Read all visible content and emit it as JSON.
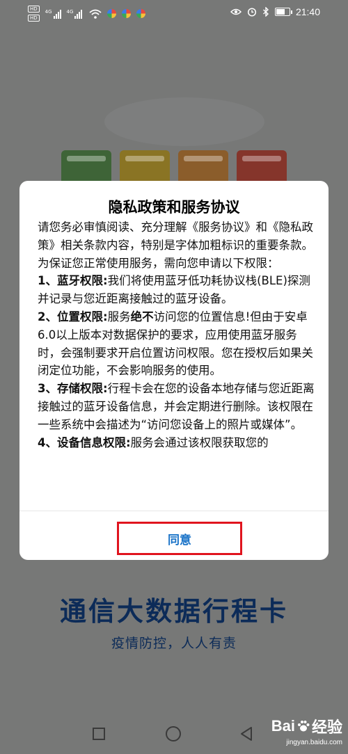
{
  "status_bar": {
    "left_badges": [
      "HD",
      "HD"
    ],
    "network_tags": [
      "4G",
      "4G"
    ],
    "time": "21:40",
    "battery_level": 0.75,
    "icons": [
      "eye-icon",
      "alarm-icon",
      "bluetooth-icon",
      "battery-icon"
    ]
  },
  "background": {
    "title": "通信大数据行程卡",
    "subtitle": "疫情防控，人人有责"
  },
  "dialog": {
    "title": "隐私政策和服务协议",
    "intro": "请您务必审慎阅读、充分理解《服务协议》和《隐私政策》相关条款内容，特别是字体加粗标识的重要条款。为保证您正常使用服务，需向您申请以下权限：",
    "p1_head": "1、蓝牙权限:",
    "p1_text": "我们将使用蓝牙低功耗协议栈(BLE)探测并记录与您近距离接触过的蓝牙设备。",
    "p2_head": "2、位置权限:",
    "p2_text_a": "服务",
    "p2_bold": "绝不",
    "p2_text_b": "访问您的位置信息!但由于安卓6.0以上版本对数据保护的要求，应用使用蓝牙服务时，会强制要求开启位置访问权限。您在授权后如果关闭定位功能，不会影响服务的使用。",
    "p3_head": "3、存储权限:",
    "p3_text": "行程卡会在您的设备本地存储与您近距离接触过的蓝牙设备信息，并会定期进行删除。该权限在一些系统中会描述为“访问您设备上的照片或媒体”。",
    "p4_head": "4、设备信息权限:",
    "p4_text": "服务会通过该权限获取您的",
    "agree_label": "同意"
  },
  "watermark": {
    "brand_a": "Bai",
    "brand_b": "经验",
    "url": "jingyan.baidu.com"
  },
  "colors": {
    "accent": "#1a73c8",
    "highlight_border": "#e0141e",
    "brand_navy": "#0c2b58",
    "overlay": "#777877"
  }
}
